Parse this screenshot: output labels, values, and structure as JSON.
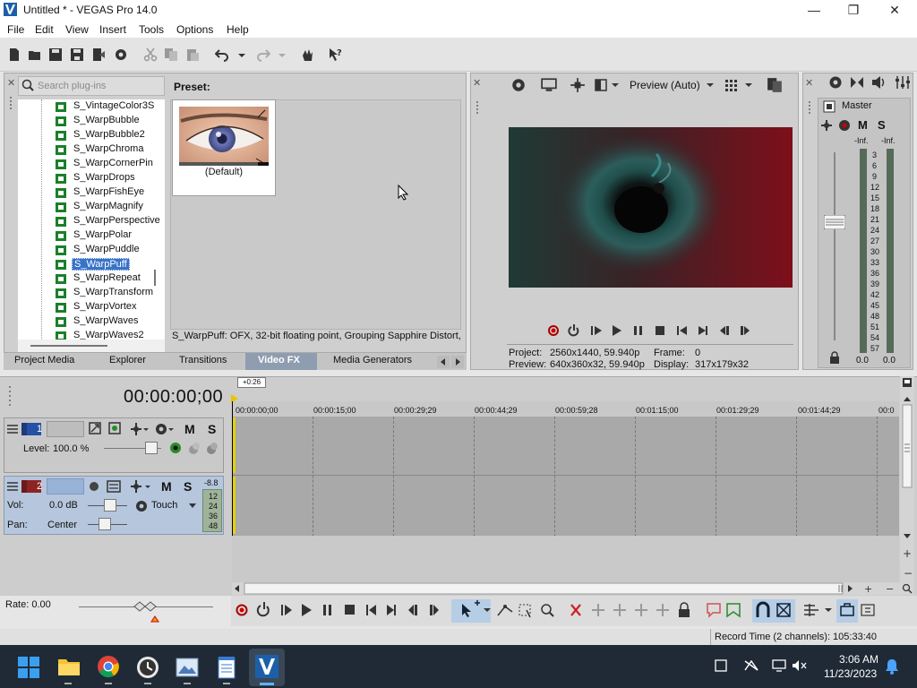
{
  "window": {
    "title": "Untitled * - VEGAS Pro 14.0",
    "minimize_glyph": "—",
    "restore_glyph": "❐",
    "close_glyph": "✕"
  },
  "menu": [
    "File",
    "Edit",
    "View",
    "Insert",
    "Tools",
    "Options",
    "Help"
  ],
  "fx_panel": {
    "search_placeholder": "Search plug-ins",
    "preset_label": "Preset:",
    "preset_name": "(Default)",
    "plugins": [
      "S_VintageColor3S",
      "S_WarpBubble",
      "S_WarpBubble2",
      "S_WarpChroma",
      "S_WarpCornerPin",
      "S_WarpDrops",
      "S_WarpFishEye",
      "S_WarpMagnify",
      "S_WarpPerspective",
      "S_WarpPolar",
      "S_WarpPuddle",
      "S_WarpPuff",
      "S_WarpRepeat",
      "S_WarpTransform",
      "S_WarpVortex",
      "S_WarpWaves",
      "S_WarpWaves2"
    ],
    "selected_plugin": "S_WarpPuff",
    "description": "S_WarpPuff: OFX, 32-bit floating point, Grouping  Sapphire Distort,",
    "tabs": [
      "Project Media",
      "Explorer",
      "Transitions",
      "Video FX",
      "Media Generators"
    ],
    "active_tab": "Video FX"
  },
  "preview": {
    "mode": "Preview (Auto)",
    "project_label": "Project:",
    "project_value": "2560x1440, 59.940p",
    "preview_label": "Preview:",
    "preview_value": "640x360x32, 59.940p",
    "frame_label": "Frame:",
    "frame_value": "0",
    "display_label": "Display:",
    "display_value": "317x179x32"
  },
  "master": {
    "title": "Master",
    "m": "M",
    "s": "S",
    "inf_left": "-Inf.",
    "inf_right": "-Inf.",
    "scale": [
      "3",
      "6",
      "9",
      "12",
      "15",
      "18",
      "21",
      "24",
      "27",
      "30",
      "33",
      "36",
      "39",
      "42",
      "45",
      "48",
      "51",
      "54",
      "57"
    ],
    "left_value": "0.0",
    "right_value": "0.0"
  },
  "timeline": {
    "cursor_time": "00:00:00;00",
    "cursor_flag": "+0:26",
    "ruler": [
      "00:00:00;00",
      "00:00:15;00",
      "00:00:29;29",
      "00:00:44;29",
      "00:00:59;28",
      "00:01:15;00",
      "00:01:29;29",
      "00:01:44;29",
      "00:0"
    ],
    "video_track": {
      "number": "1",
      "level_label": "Level:",
      "level_value": "100.0 %",
      "m": "M",
      "s": "S"
    },
    "audio_track": {
      "number": "2",
      "vol_label": "Vol:",
      "vol_value": "0.0 dB",
      "pan_label": "Pan:",
      "pan_value": "Center",
      "automation": "Touch",
      "m": "M",
      "s": "S",
      "meter_top": "-8.8",
      "meter_scale": [
        "12",
        "24",
        "36",
        "48"
      ]
    },
    "rate_label": "Rate: 0.00"
  },
  "status": {
    "record_time": "Record Time (2 channels): 105:33:40"
  },
  "taskbar": {
    "time": "3:06 AM",
    "date": "11/23/2023"
  }
}
